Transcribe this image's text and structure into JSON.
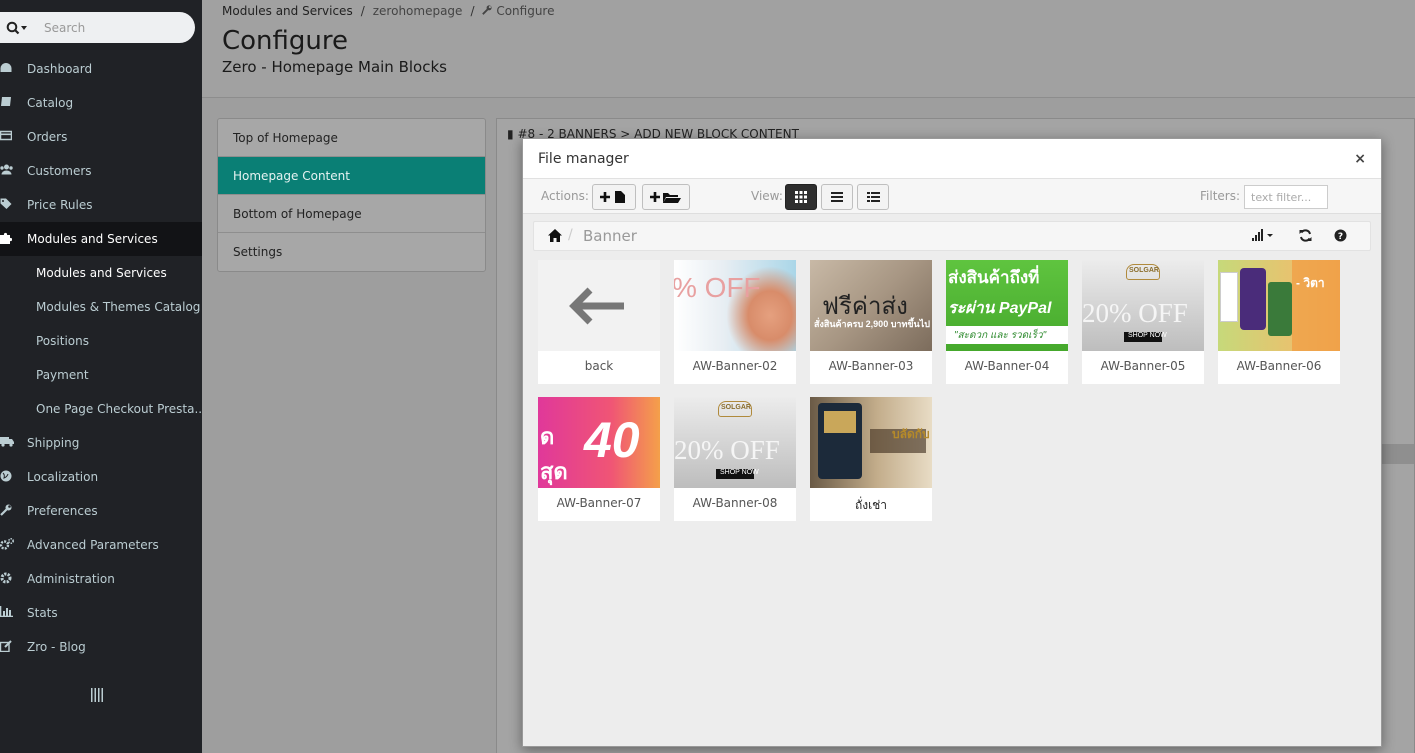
{
  "sidebar": {
    "search_placeholder": "Search",
    "items": [
      {
        "label": "Dashboard",
        "icon": "dashboard-icon"
      },
      {
        "label": "Catalog",
        "icon": "catalog-icon"
      },
      {
        "label": "Orders",
        "icon": "orders-icon"
      },
      {
        "label": "Customers",
        "icon": "customers-icon"
      },
      {
        "label": "Price Rules",
        "icon": "price-rules-icon"
      },
      {
        "label": "Modules and Services",
        "icon": "puzzle-icon"
      }
    ],
    "subitems": [
      {
        "label": "Modules and Services"
      },
      {
        "label": "Modules & Themes Catalog"
      },
      {
        "label": "Positions"
      },
      {
        "label": "Payment"
      },
      {
        "label": "One Page Checkout Presta..."
      }
    ],
    "items_after": [
      {
        "label": "Shipping",
        "icon": "truck-icon"
      },
      {
        "label": "Localization",
        "icon": "globe-icon"
      },
      {
        "label": "Preferences",
        "icon": "wrench-icon"
      },
      {
        "label": "Advanced Parameters",
        "icon": "gears-icon"
      },
      {
        "label": "Administration",
        "icon": "gear-icon"
      },
      {
        "label": "Stats",
        "icon": "stats-icon"
      },
      {
        "label": "Zro - Blog",
        "icon": "pencil-icon"
      }
    ]
  },
  "header": {
    "breadcrumb": [
      "Modules and Services",
      "zerohomepage",
      "Configure"
    ],
    "title": "Configure",
    "subtitle": "Zero - Homepage Main Blocks"
  },
  "tabs": [
    "Top of Homepage",
    "Homepage Content",
    "Bottom of Homepage",
    "Settings"
  ],
  "panel": {
    "heading": "#8 - 2 BANNERS > ADD NEW BLOCK CONTENT"
  },
  "modal": {
    "title": "File manager",
    "close": "×",
    "actions_label": "Actions:",
    "view_label": "View:",
    "filters_label": "Filters:",
    "filter_placeholder": "text filter...",
    "folder": "Banner"
  },
  "files": [
    {
      "name": "back"
    },
    {
      "name": "AW-Banner-02",
      "text": "% OFF"
    },
    {
      "name": "AW-Banner-03",
      "text": "ฟรีค่าส่ง",
      "text2": "สั่งสินค้าครบ 2,900 บาทขึ้นไป"
    },
    {
      "name": "AW-Banner-04",
      "text": "ส่งสินค้าถึงที่",
      "text2": "ระผ่าน PayPal",
      "text3": "\"สะดวก และ รวดเร็ว\""
    },
    {
      "name": "AW-Banner-05",
      "text": "20% OFF",
      "text2": "SHOP NOW",
      "brand": "SOLGAR"
    },
    {
      "name": "AW-Banner-06",
      "text": "- วิตา"
    },
    {
      "name": "AW-Banner-07",
      "text": "40"
    },
    {
      "name": "AW-Banner-08",
      "text": "20% OFF",
      "text2": "SHOP NOW",
      "brand": "SOLGAR"
    },
    {
      "name": "ถั่งเช่า",
      "text": "บลัดกับ"
    }
  ]
}
